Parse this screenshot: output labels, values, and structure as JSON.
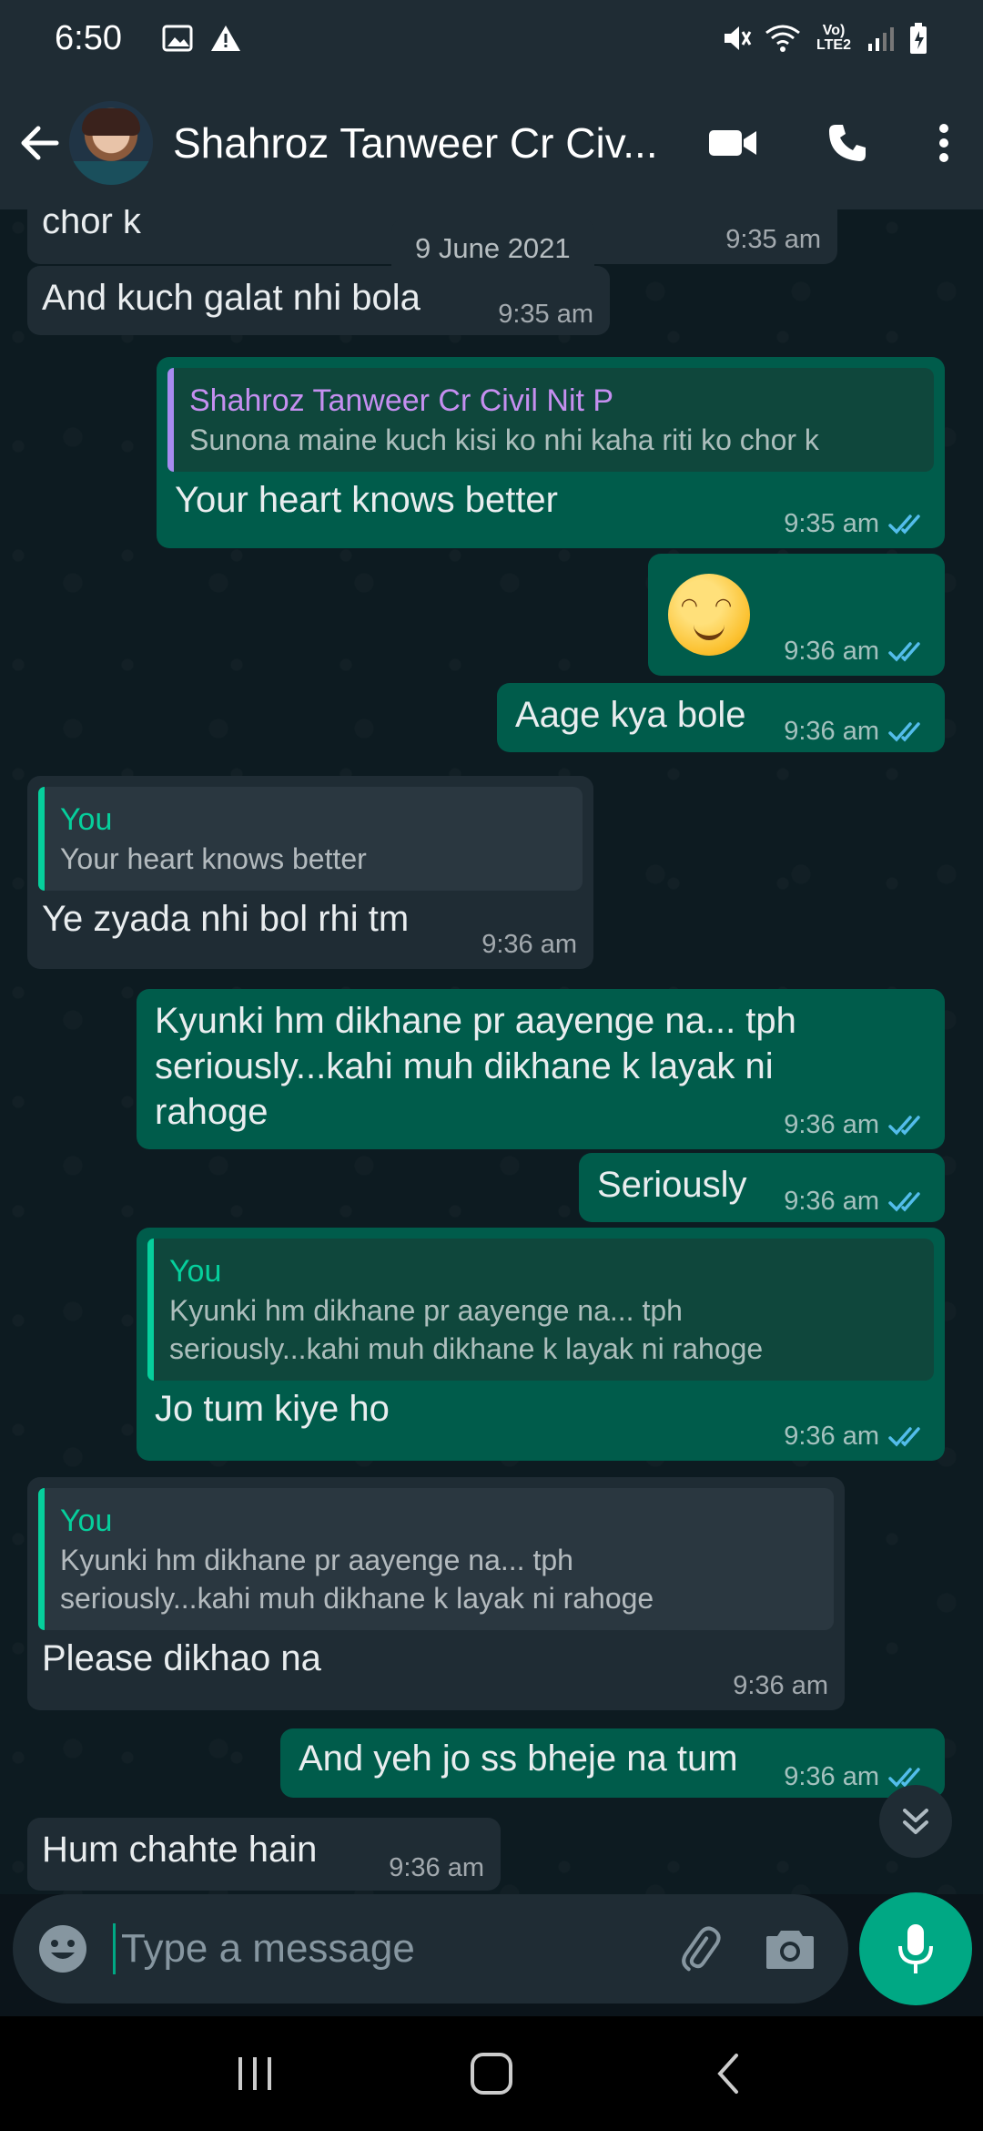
{
  "status_bar": {
    "time": "6:50",
    "network": "Vo) LTE2"
  },
  "header": {
    "contact_name": "Shahroz Tanweer Cr Civ..."
  },
  "chat": {
    "date_chip": "9 June 2021",
    "messages": [
      {
        "text": "chor k",
        "time": "9:35 am"
      },
      {
        "text": "And kuch galat nhi bola",
        "time": "9:35 am"
      },
      {
        "quote_name": "Shahroz Tanweer Cr Civil Nit P",
        "quote_text": "Sunona maine kuch kisi ko nhi kaha riti ko chor k",
        "text": "Your heart knows better",
        "time": "9:35 am"
      },
      {
        "emoji": "☺️",
        "time": "9:36 am"
      },
      {
        "text": "Aage kya bole",
        "time": "9:36 am"
      },
      {
        "quote_name": "You",
        "quote_text": "Your heart knows better",
        "text": "Ye zyada nhi bol rhi tm",
        "time": "9:36 am"
      },
      {
        "text": "Kyunki hm dikhane pr aayenge na... tph seriously...kahi muh dikhane k layak ni rahoge",
        "time": "9:36 am"
      },
      {
        "text": "Seriously",
        "time": "9:36 am"
      },
      {
        "quote_name": "You",
        "quote_text": "Kyunki hm dikhane pr aayenge na... tph seriously...kahi muh dikhane k layak ni rahoge",
        "text": "Jo tum kiye ho",
        "time": "9:36 am"
      },
      {
        "quote_name": "You",
        "quote_text": "Kyunki hm dikhane pr aayenge na... tph seriously...kahi muh dikhane k layak ni rahoge",
        "text": "Please dikhao na",
        "time": "9:36 am"
      },
      {
        "text": "And yeh jo ss bheje na tum",
        "time": "9:36 am"
      },
      {
        "text": "Hum chahte hain",
        "time": "9:36 am"
      }
    ]
  },
  "composer": {
    "placeholder": "Type a message"
  },
  "colors": {
    "incoming": "#1f2c34",
    "outgoing": "#005c4b",
    "accent": "#00a884",
    "read_tick": "#53bdeb"
  },
  "icons": [
    "back-arrow-icon",
    "video-call-icon",
    "phone-icon",
    "more-vert-icon",
    "emoji-icon",
    "attach-icon",
    "camera-icon",
    "mic-icon",
    "chevron-double-down-icon",
    "recents-icon",
    "home-icon",
    "nav-back-icon"
  ]
}
